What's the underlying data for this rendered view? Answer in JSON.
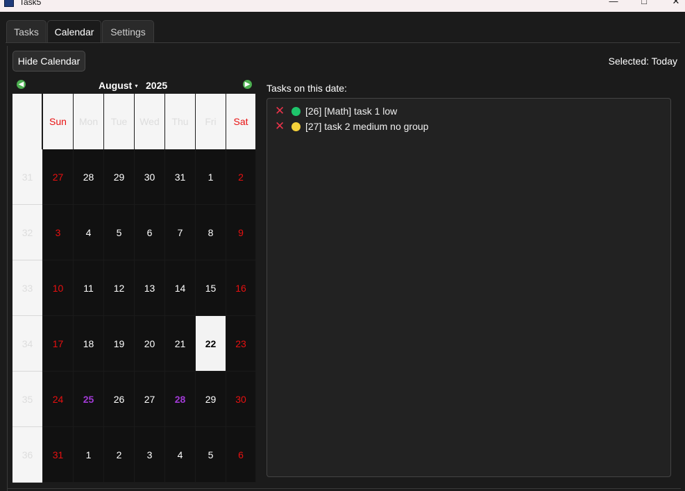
{
  "window": {
    "title": "Task5"
  },
  "tabs": [
    {
      "label": "Tasks",
      "active": false
    },
    {
      "label": "Calendar",
      "active": true
    },
    {
      "label": "Settings",
      "active": false
    }
  ],
  "toolbar": {
    "hide_calendar_label": "Hide Calendar",
    "selected_text": "Selected: Today"
  },
  "calendar": {
    "month": "August",
    "year": "2025",
    "weekday_headers": [
      "Sun",
      "Mon",
      "Tue",
      "Wed",
      "Thu",
      "Fri",
      "Sat"
    ],
    "weeks": [
      {
        "number": "31",
        "days": [
          "27",
          "28",
          "29",
          "30",
          "31",
          "1",
          "2"
        ]
      },
      {
        "number": "32",
        "days": [
          "3",
          "4",
          "5",
          "6",
          "7",
          "8",
          "9"
        ]
      },
      {
        "number": "33",
        "days": [
          "10",
          "11",
          "12",
          "13",
          "14",
          "15",
          "16"
        ]
      },
      {
        "number": "34",
        "days": [
          "17",
          "18",
          "19",
          "20",
          "21",
          "22",
          "23"
        ]
      },
      {
        "number": "35",
        "days": [
          "24",
          "25",
          "26",
          "27",
          "28",
          "29",
          "30"
        ]
      },
      {
        "number": "36",
        "days": [
          "31",
          "1",
          "2",
          "3",
          "4",
          "5",
          "6"
        ]
      }
    ],
    "today": "22",
    "days_with_tasks": [
      "25",
      "28"
    ],
    "weekend_color": "#e81010",
    "task_day_color": "#a23ad6"
  },
  "tasks_panel": {
    "label": "Tasks on this date:",
    "items": [
      {
        "text": "[26] [Math] task 1 low",
        "priority_color": "#1ec46b",
        "delete_icon": "close-icon"
      },
      {
        "text": "[27] task 2 medium no group",
        "priority_color": "#f5d13a",
        "delete_icon": "close-icon"
      }
    ]
  }
}
